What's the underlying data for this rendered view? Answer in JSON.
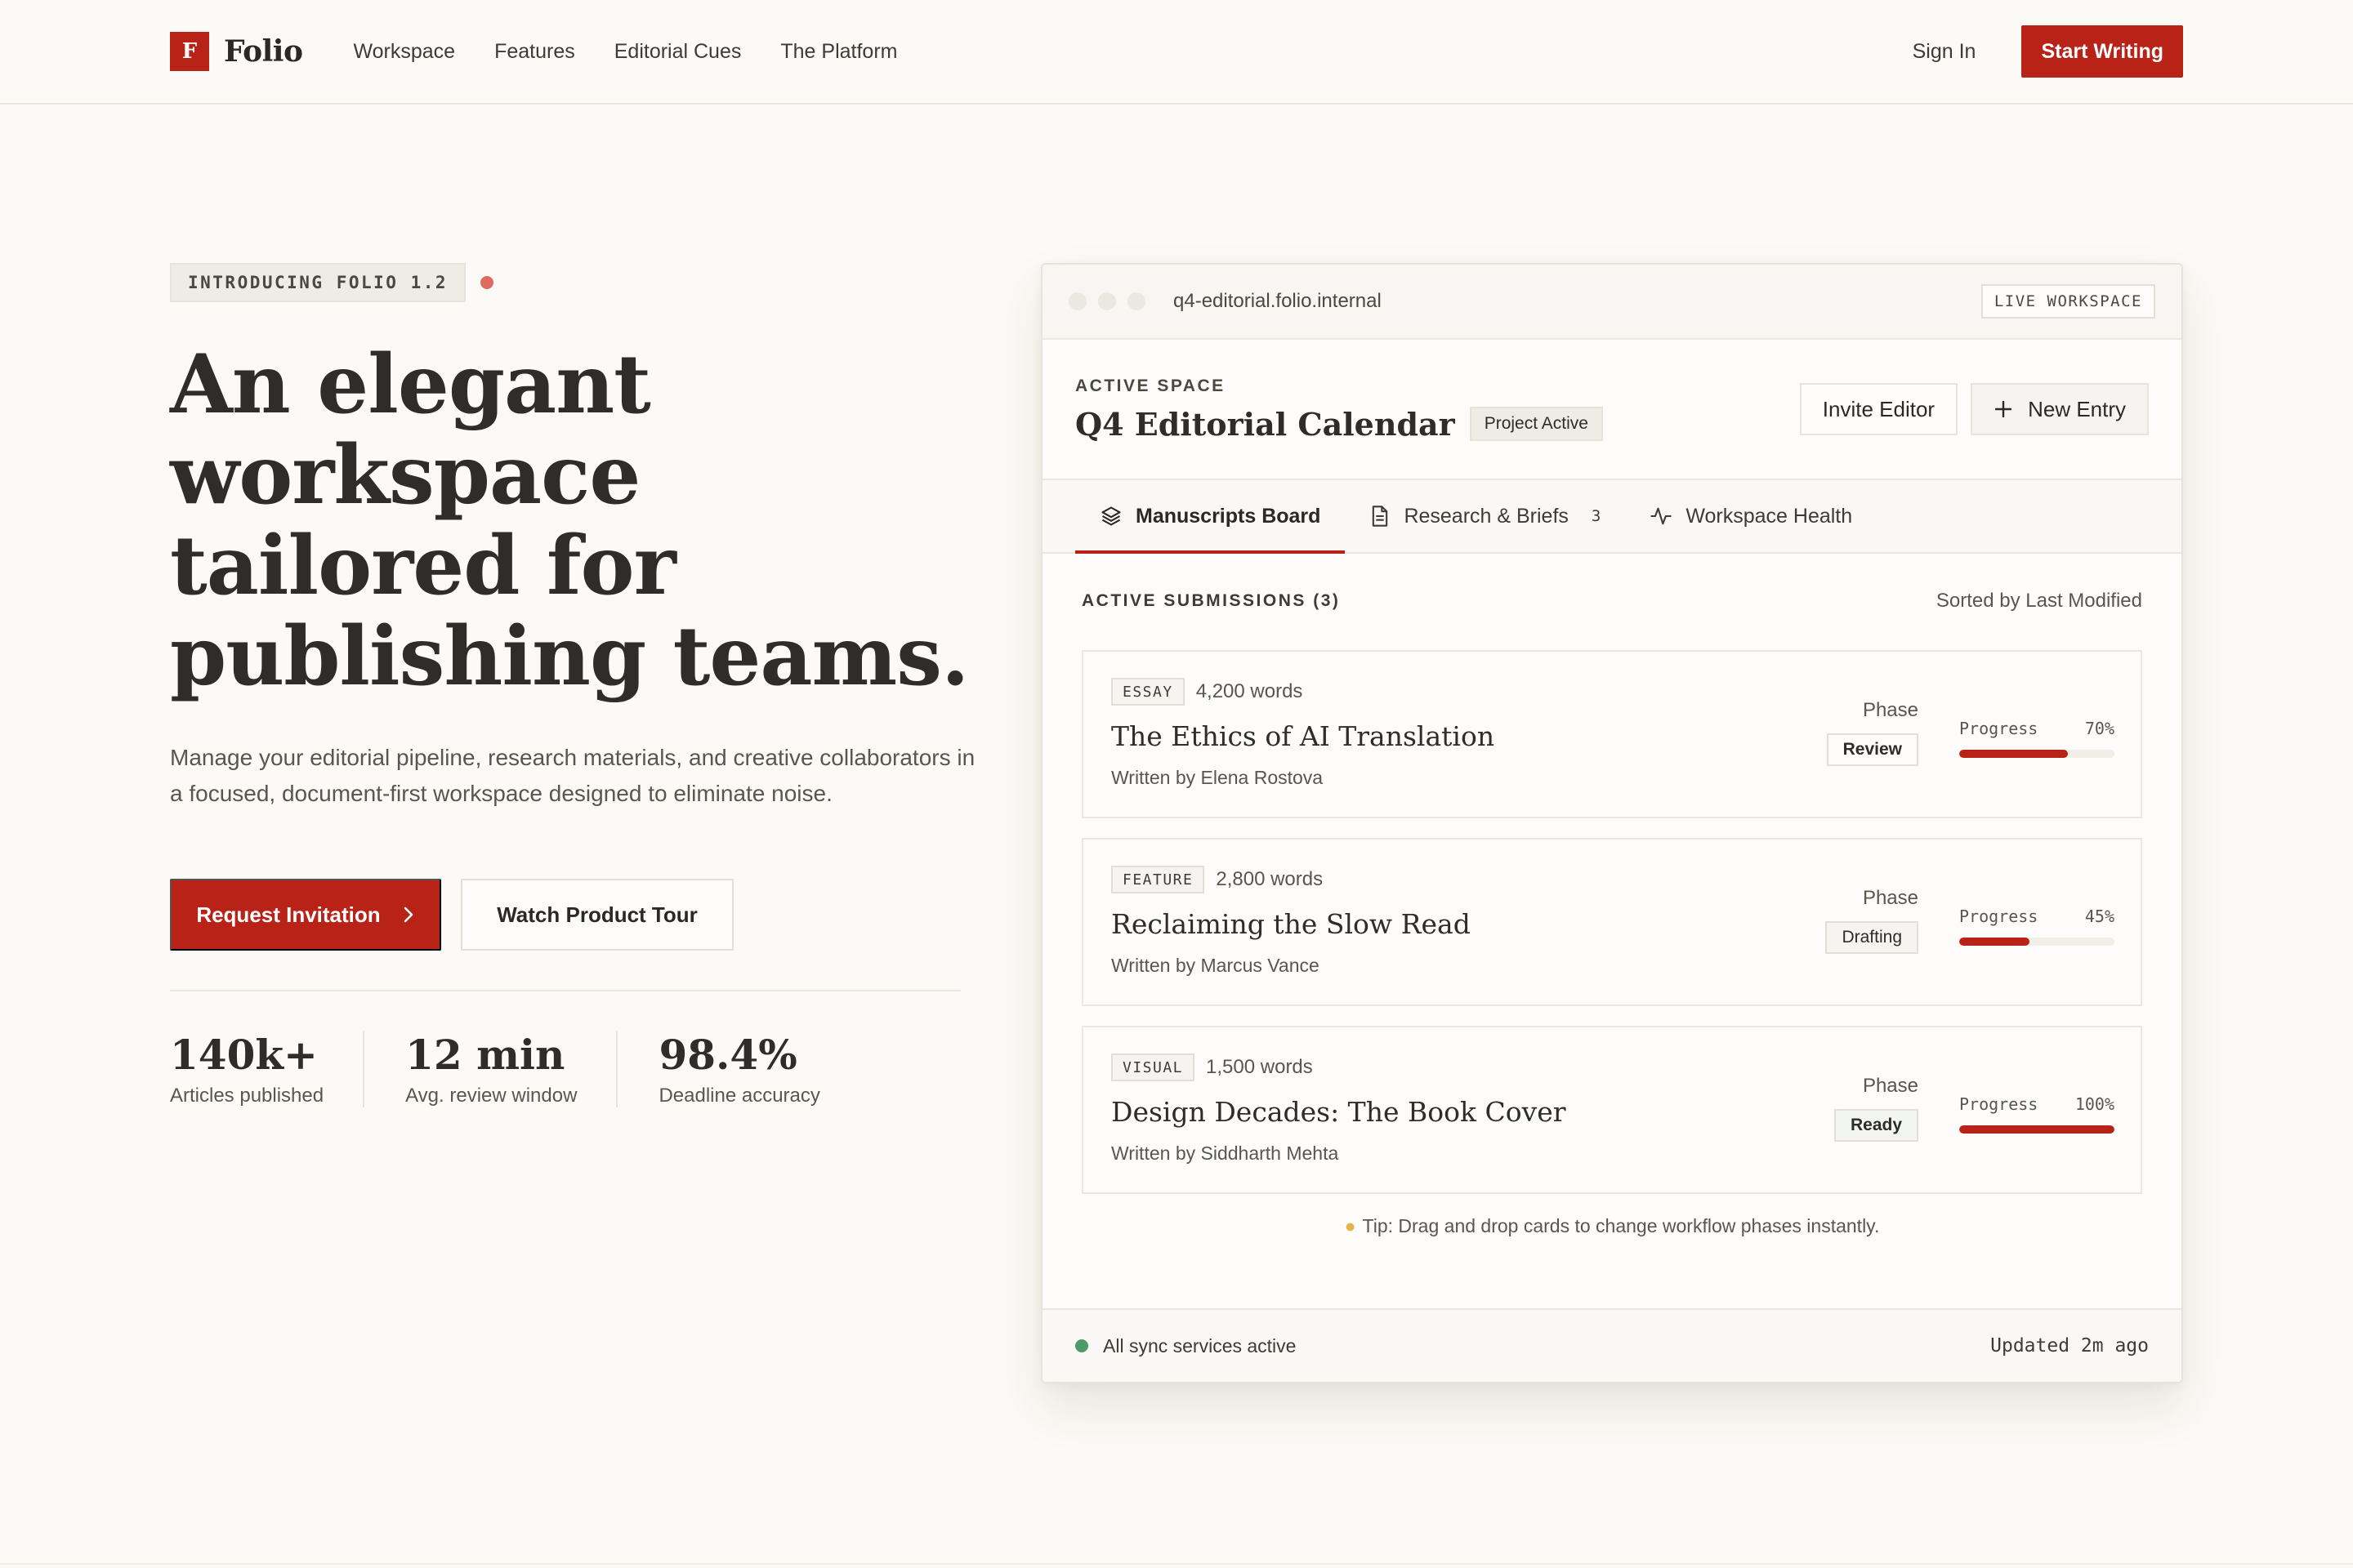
{
  "nav": {
    "logo_mark": "F",
    "logo_text": "Folio",
    "links": [
      "Workspace",
      "Features",
      "Editorial Cues",
      "The Platform"
    ],
    "sign_in": "Sign In",
    "cta": "Start Writing"
  },
  "hero": {
    "badge": "INTRODUCING FOLIO 1.2",
    "title": "An elegant workspace tailored for publishing teams.",
    "subtitle": "Manage your editorial pipeline, research materials, and creative collaborators in a focused, document-first workspace designed to eliminate noise.",
    "primary_cta": "Request Invitation",
    "secondary_cta": "Watch Product Tour",
    "stats": [
      {
        "value": "140k+",
        "label": "Articles published"
      },
      {
        "value": "12 min",
        "label": "Avg. review window"
      },
      {
        "value": "98.4%",
        "label": "Deadline accuracy"
      }
    ]
  },
  "window": {
    "url": "q4-editorial.folio.internal",
    "live_tag": "LIVE WORKSPACE",
    "eyebrow": "ACTIVE SPACE",
    "title": "Q4 Editorial Calendar",
    "status_pill": "Project Active",
    "invite_btn": "Invite Editor",
    "new_btn": "New Entry",
    "tabs": [
      {
        "label": "Manuscripts Board",
        "icon": "layers-icon"
      },
      {
        "label": "Research & Briefs",
        "icon": "document-icon",
        "count": "3"
      },
      {
        "label": "Workspace Health",
        "icon": "activity-icon"
      }
    ],
    "list_title": "ACTIVE SUBMISSIONS (3)",
    "sort_label": "Sorted by Last Modified",
    "phase_label": "Phase",
    "progress_label": "Progress",
    "cards": [
      {
        "type": "ESSAY",
        "words": "4,200 words",
        "title": "The Ethics of AI Translation",
        "author": "Written by Elena Rostova",
        "phase": "Review",
        "progress_text": "70%",
        "progress": 70
      },
      {
        "type": "FEATURE",
        "words": "2,800 words",
        "title": "Reclaiming the Slow Read",
        "author": "Written by Marcus Vance",
        "phase": "Drafting",
        "progress_text": "45%",
        "progress": 45
      },
      {
        "type": "VISUAL",
        "words": "1,500 words",
        "title": "Design Decades: The Book Cover",
        "author": "Written by Siddharth Mehta",
        "phase": "Ready",
        "progress_text": "100%",
        "progress": 100
      }
    ],
    "tip": "Tip: Drag and drop cards to change workflow phases instantly.",
    "sync_status": "All sync services active",
    "updated": "Updated 2m ago"
  },
  "colors": {
    "accent": "#b82217",
    "background": "#fcfaf6",
    "success": "#4f9a6a"
  }
}
